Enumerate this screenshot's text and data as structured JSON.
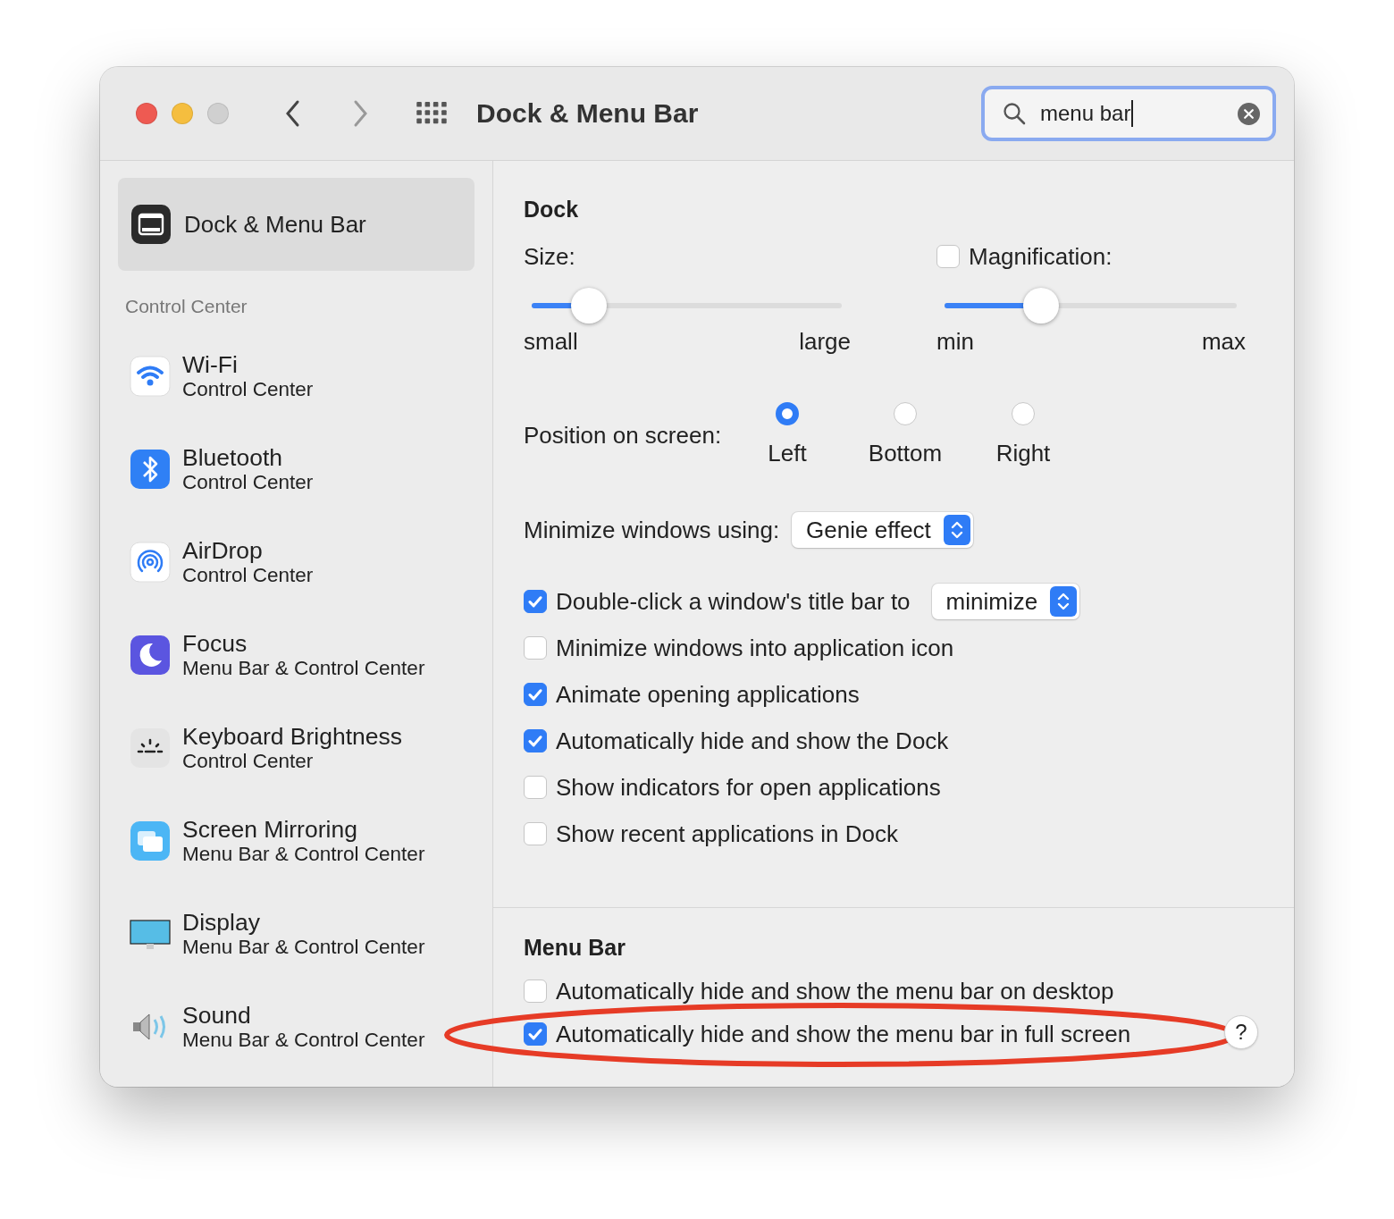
{
  "window": {
    "title": "Dock & Menu Bar"
  },
  "search": {
    "value": "menu bar"
  },
  "sidebar": {
    "selected_item": {
      "title": "Dock & Menu Bar",
      "kind": "dock",
      "selected": true
    },
    "section": "Control Center",
    "items": [
      {
        "title": "Wi-Fi",
        "subtitle": "Control Center",
        "kind": "wifi"
      },
      {
        "title": "Bluetooth",
        "subtitle": "Control Center",
        "kind": "bluetooth"
      },
      {
        "title": "AirDrop",
        "subtitle": "Control Center",
        "kind": "airdrop"
      },
      {
        "title": "Focus",
        "subtitle": "Menu Bar & Control Center",
        "kind": "focus"
      },
      {
        "title": "Keyboard Brightness",
        "subtitle": "Control Center",
        "kind": "keyboard"
      },
      {
        "title": "Screen Mirroring",
        "subtitle": "Menu Bar & Control Center",
        "kind": "mirroring"
      },
      {
        "title": "Display",
        "subtitle": "Menu Bar & Control Center",
        "kind": "display"
      },
      {
        "title": "Sound",
        "subtitle": "Menu Bar & Control Center",
        "kind": "sound"
      }
    ]
  },
  "dock": {
    "heading": "Dock",
    "size": {
      "label": "Size:",
      "level": 0.185,
      "min_label": "small",
      "max_label": "large"
    },
    "magnification": {
      "label": "Magnification:",
      "checked": false,
      "level": 0.33,
      "min_label": "min",
      "max_label": "max"
    },
    "position": {
      "label": "Position on screen:",
      "options": [
        {
          "label": "Left",
          "selected": true
        },
        {
          "label": "Bottom",
          "selected": false
        },
        {
          "label": "Right",
          "selected": false
        }
      ]
    },
    "minimize": {
      "label": "Minimize windows using:",
      "value": "Genie effect"
    },
    "options": [
      {
        "label": "Double-click a window's title bar to",
        "checked": true,
        "select": "minimize"
      },
      {
        "label": "Minimize windows into application icon",
        "checked": false
      },
      {
        "label": "Animate opening applications",
        "checked": true
      },
      {
        "label": "Automatically hide and show the Dock",
        "checked": true
      },
      {
        "label": "Show indicators for open applications",
        "checked": false
      },
      {
        "label": "Show recent applications in Dock",
        "checked": false
      }
    ]
  },
  "menu_bar": {
    "heading": "Menu Bar",
    "options": [
      {
        "label": "Automatically hide and show the menu bar on desktop",
        "checked": false,
        "highlighted": false
      },
      {
        "label": "Automatically hide and show the menu bar in full screen",
        "checked": true,
        "highlighted": true
      }
    ]
  },
  "help_button": "?"
}
